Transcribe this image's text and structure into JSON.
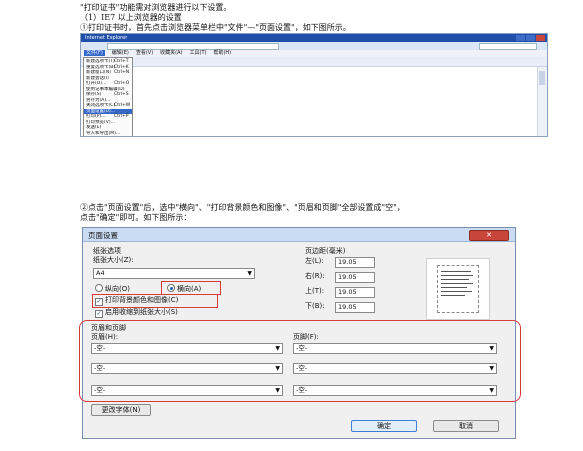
{
  "doc": {
    "line1": "\"打印证书\"功能需对浏览器进行以下设置。",
    "line2": "（1）IE7 以上浏览器的设置",
    "line3": "①打印证书时，首先点击浏览器菜单栏中\"文件\"—\"页面设置\"，如下图所示。",
    "line4": "②点击\"页面设置\"后，选中\"横向\"、\"打印背景颜色和图像\"、\"页眉和页脚\"全部设置成\"空\"，",
    "line5": "点击\"确定\"即可。如下图所示："
  },
  "browser": {
    "title": "Internet Explorer",
    "menu": [
      "文件(F)",
      "编辑(E)",
      "查看(V)",
      "收藏夹(A)",
      "工具(T)",
      "帮助(H)"
    ],
    "file_menu": [
      {
        "label": "新建选项卡(T)",
        "shortcut": "Ctrl+T"
      },
      {
        "label": "重复选项卡(B)",
        "shortcut": "Ctrl+K"
      },
      {
        "label": "新建窗口(N)",
        "shortcut": "Ctrl+N"
      },
      {
        "label": "新建会话(I)",
        "shortcut": ""
      },
      {
        "label": "打开(O)...",
        "shortcut": "Ctrl+O"
      },
      {
        "label": "使用记事本编辑(D)",
        "shortcut": ""
      },
      {
        "label": "保存(S)",
        "shortcut": "Ctrl+S"
      },
      {
        "label": "另存为(A)...",
        "shortcut": ""
      },
      {
        "label": "关闭选项卡(C)",
        "shortcut": "Ctrl+W"
      },
      {
        "label": "页面设置(U)...",
        "shortcut": "",
        "selected": true
      },
      {
        "label": "打印(P)...",
        "shortcut": "Ctrl+P"
      },
      {
        "label": "打印预览(V)...",
        "shortcut": ""
      },
      {
        "label": "发送(E)",
        "shortcut": ""
      },
      {
        "label": "导入和导出(M)...",
        "shortcut": ""
      },
      {
        "label": "属性(R)",
        "shortcut": ""
      },
      {
        "label": "脱机工作(W)",
        "shortcut": ""
      },
      {
        "label": "退出(X)",
        "shortcut": ""
      }
    ]
  },
  "dialog": {
    "title": "页面设置",
    "close_label": "✕",
    "paper_options": "纸张选项",
    "paper_size_label": "纸张大小(Z):",
    "paper_size_value": "A4",
    "portrait_label": "纵向(O)",
    "landscape_label": "横向(A)",
    "print_bg_label": "打印背景颜色和图像(C)",
    "shrink_label": "启用收缩到纸张大小(S)",
    "margins_title": "页边距(毫米)",
    "margin_left_label": "左(L):",
    "margin_left_value": "19.05",
    "margin_right_label": "右(R):",
    "margin_right_value": "19.05",
    "margin_top_label": "上(T):",
    "margin_top_value": "19.05",
    "margin_bottom_label": "下(B):",
    "margin_bottom_value": "19.05",
    "header_footer_title": "页眉和页脚",
    "header_label": "页眉(H):",
    "footer_label": "页脚(F):",
    "header_values": [
      "-空-",
      "-空-",
      "-空-"
    ],
    "footer_values": [
      "-空-",
      "-空-",
      "-空-"
    ],
    "change_font_label": "更改字体(N)",
    "ok_label": "确定",
    "cancel_label": "取消"
  },
  "colors": {
    "highlight": "#d83a3a",
    "title_bar": "#1f4fa8"
  }
}
